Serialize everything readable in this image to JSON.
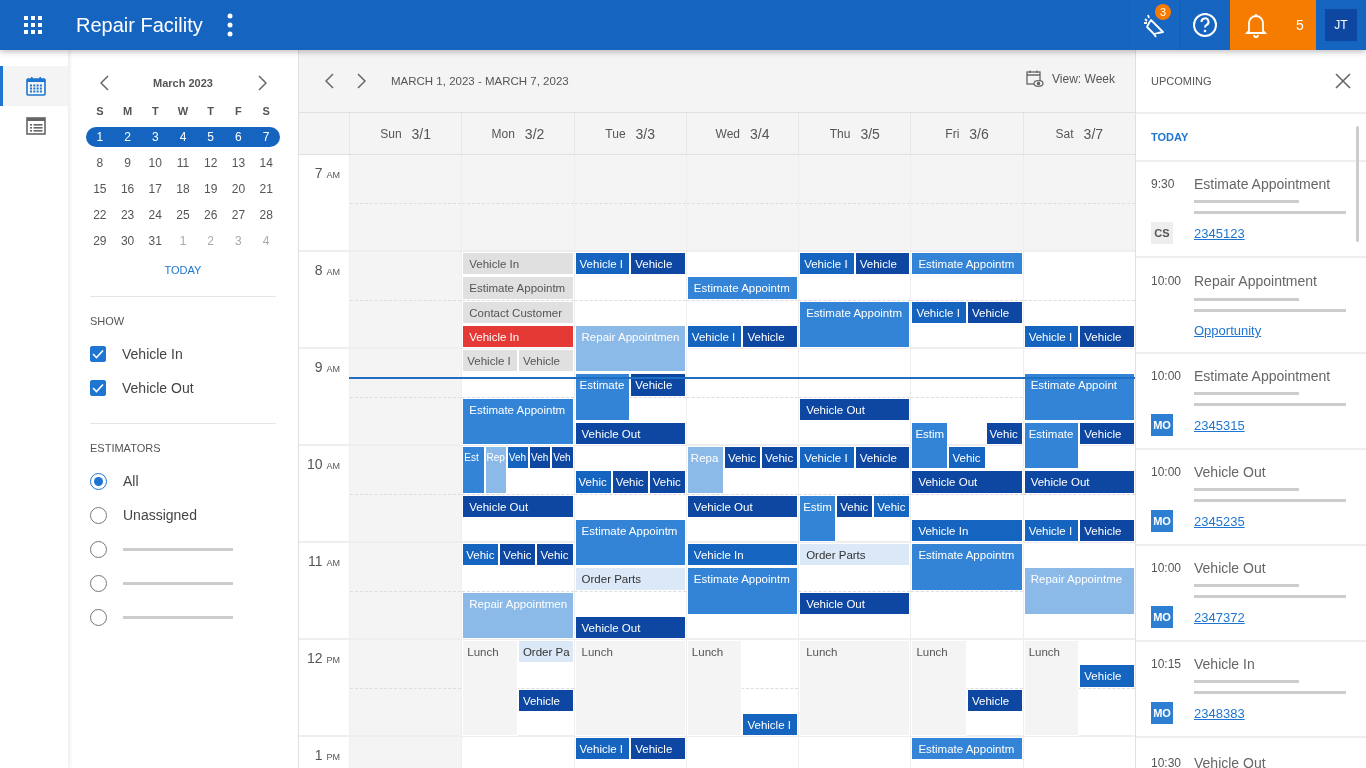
{
  "app_bar": {
    "title": "Repair Facility",
    "announcements_badge": "3",
    "notifications_count": "5",
    "user_initials": "JT"
  },
  "rail": [
    {
      "kind": "calendar",
      "selected": true
    },
    {
      "kind": "list",
      "selected": false
    }
  ],
  "mini_calendar": {
    "month": "March 2023",
    "weekdays": [
      "S",
      "M",
      "T",
      "W",
      "T",
      "F",
      "S"
    ],
    "weeks": [
      {
        "selected": true,
        "days": [
          {
            "label": "1",
            "muted": false
          },
          {
            "label": "2",
            "muted": false
          },
          {
            "label": "3",
            "muted": false
          },
          {
            "label": "4",
            "muted": false
          },
          {
            "label": "5",
            "muted": false
          },
          {
            "label": "6",
            "muted": false
          },
          {
            "label": "7",
            "muted": false
          }
        ]
      },
      {
        "selected": false,
        "days": [
          {
            "label": "8",
            "muted": false
          },
          {
            "label": "9",
            "muted": false
          },
          {
            "label": "10",
            "muted": false
          },
          {
            "label": "11",
            "muted": false
          },
          {
            "label": "12",
            "muted": false
          },
          {
            "label": "13",
            "muted": false
          },
          {
            "label": "14",
            "muted": false
          }
        ]
      },
      {
        "selected": false,
        "days": [
          {
            "label": "15",
            "muted": false
          },
          {
            "label": "16",
            "muted": false
          },
          {
            "label": "17",
            "muted": false
          },
          {
            "label": "18",
            "muted": false
          },
          {
            "label": "19",
            "muted": false
          },
          {
            "label": "20",
            "muted": false
          },
          {
            "label": "21",
            "muted": false
          }
        ]
      },
      {
        "selected": false,
        "days": [
          {
            "label": "22",
            "muted": false
          },
          {
            "label": "23",
            "muted": false
          },
          {
            "label": "24",
            "muted": false
          },
          {
            "label": "25",
            "muted": false
          },
          {
            "label": "26",
            "muted": false
          },
          {
            "label": "27",
            "muted": false
          },
          {
            "label": "28",
            "muted": false
          }
        ]
      },
      {
        "selected": false,
        "days": [
          {
            "label": "29",
            "muted": false
          },
          {
            "label": "30",
            "muted": false
          },
          {
            "label": "31",
            "muted": false
          },
          {
            "label": "1",
            "muted": true
          },
          {
            "label": "2",
            "muted": true
          },
          {
            "label": "3",
            "muted": true
          },
          {
            "label": "4",
            "muted": true
          }
        ]
      }
    ],
    "today_link": "TODAY"
  },
  "show": {
    "title": "SHOW",
    "options": [
      {
        "label": "Vehicle In",
        "checked": true
      },
      {
        "label": "Vehicle Out",
        "checked": true
      }
    ]
  },
  "estimators": {
    "title": "ESTIMATORS",
    "options": [
      {
        "kind": "text",
        "label": "All",
        "selected": true
      },
      {
        "kind": "text",
        "label": "Unassigned",
        "selected": false
      },
      {
        "kind": "skeleton",
        "selected": false
      },
      {
        "kind": "skeleton",
        "selected": false
      },
      {
        "kind": "skeleton",
        "selected": false
      }
    ]
  },
  "toolbar": {
    "range": "MARCH 1, 2023 - MARCH 7, 2023",
    "view": "View: Week"
  },
  "hours": [
    {
      "hour": "7",
      "period": "AM",
      "open": false,
      "now": false
    },
    {
      "hour": "8",
      "period": "AM",
      "open": true,
      "now": false
    },
    {
      "hour": "9",
      "period": "AM",
      "open": true,
      "now": true
    },
    {
      "hour": "10",
      "period": "AM",
      "open": true,
      "now": false
    },
    {
      "hour": "11",
      "period": "AM",
      "open": true,
      "now": false
    },
    {
      "hour": "12",
      "period": "PM",
      "open": true,
      "now": false
    },
    {
      "hour": "1",
      "period": "PM",
      "open": true,
      "now": false
    }
  ],
  "days": [
    {
      "weekday": "Sun",
      "date": "3/1",
      "closed": true
    },
    {
      "weekday": "Mon",
      "date": "3/2",
      "closed": false,
      "quarters": [
        [
          {
            "kind": "free"
          }
        ],
        [
          {
            "kind": "free"
          }
        ],
        [
          {
            "kind": "free"
          }
        ],
        [
          {
            "kind": "free"
          }
        ],
        [
          {
            "label": "Vehicle In",
            "kind": "past"
          }
        ],
        [
          {
            "label": "Estimate Appointm",
            "kind": "past"
          }
        ],
        [
          {
            "label": "Contact Customer",
            "kind": "past"
          }
        ],
        [
          {
            "label": "Vehicle In",
            "kind": "late"
          }
        ],
        [
          {
            "label": "Vehicle I",
            "kind": "past"
          },
          {
            "label": "Vehicle",
            "kind": "past"
          }
        ],
        [
          {
            "kind": "free"
          }
        ],
        [
          {
            "label": "Estimate Appointm",
            "kind": "estimate"
          }
        ],
        [
          {
            "kind": "continued"
          }
        ],
        [
          {
            "label": "Est",
            "kind": "estimate"
          },
          {
            "label": "Rep",
            "kind": "repair"
          },
          {
            "label": "Veh",
            "kind": "vehicle-in"
          },
          {
            "label": "Veh",
            "kind": "vehicle-out"
          },
          {
            "label": "Veh",
            "kind": "vehicle-out"
          }
        ],
        [
          {
            "kind": "continued"
          },
          {
            "kind": "continued"
          },
          {
            "kind": "free"
          },
          {
            "kind": "free"
          },
          {
            "kind": "free"
          }
        ],
        [
          {
            "label": "Vehicle Out",
            "kind": "vehicle-out"
          }
        ],
        [
          {
            "kind": "free"
          }
        ],
        [
          {
            "label": "Vehic",
            "kind": "vehicle-in"
          },
          {
            "label": "Vehic",
            "kind": "vehicle-out"
          },
          {
            "label": "Vehic",
            "kind": "vehicle-out"
          }
        ],
        [
          {
            "kind": "free"
          }
        ],
        [
          {
            "label": "Repair Appointmen",
            "kind": "repair"
          }
        ],
        [
          {
            "kind": "continued"
          }
        ],
        [
          {
            "label": "Lunch",
            "kind": "lunch"
          },
          {
            "label": "Order Pa",
            "kind": "order-parts"
          }
        ],
        [
          {
            "kind": "continued"
          },
          {
            "kind": "free"
          }
        ],
        [
          {
            "kind": "continued"
          },
          {
            "label": "Vehicle",
            "kind": "vehicle-out"
          }
        ],
        [
          {
            "kind": "continued"
          },
          {
            "kind": "free"
          }
        ],
        [
          {
            "kind": "free"
          }
        ]
      ]
    },
    {
      "weekday": "Tue",
      "date": "3/3",
      "closed": false,
      "quarters": [
        [
          {
            "kind": "free"
          }
        ],
        [
          {
            "kind": "free"
          }
        ],
        [
          {
            "kind": "free"
          }
        ],
        [
          {
            "kind": "free"
          }
        ],
        [
          {
            "label": "Vehicle I",
            "kind": "vehicle-in"
          },
          {
            "label": "Vehicle",
            "kind": "vehicle-out"
          }
        ],
        [
          {
            "kind": "free"
          }
        ],
        [
          {
            "kind": "free"
          }
        ],
        [
          {
            "label": "Repair Appointmen",
            "kind": "repair"
          }
        ],
        [
          {
            "kind": "continued"
          }
        ],
        [
          {
            "label": "Estimate",
            "kind": "estimate"
          },
          {
            "label": "Vehicle",
            "kind": "vehicle-out"
          }
        ],
        [
          {
            "kind": "continued"
          },
          {
            "kind": "free"
          }
        ],
        [
          {
            "label": "Vehicle Out",
            "kind": "vehicle-out"
          }
        ],
        [
          {
            "kind": "free"
          }
        ],
        [
          {
            "label": "Vehic",
            "kind": "vehicle-in"
          },
          {
            "label": "Vehic",
            "kind": "vehicle-out"
          },
          {
            "label": "Vehic",
            "kind": "vehicle-out"
          }
        ],
        [
          {
            "kind": "free"
          }
        ],
        [
          {
            "label": "Estimate Appointm",
            "kind": "estimate"
          }
        ],
        [
          {
            "kind": "continued"
          }
        ],
        [
          {
            "label": "Order Parts",
            "kind": "order-parts"
          }
        ],
        [
          {
            "kind": "free"
          }
        ],
        [
          {
            "label": "Vehicle Out",
            "kind": "vehicle-out"
          }
        ],
        [
          {
            "label": "Lunch",
            "kind": "lunch"
          }
        ],
        [
          {
            "kind": "continued"
          }
        ],
        [
          {
            "kind": "continued"
          }
        ],
        [
          {
            "kind": "continued"
          }
        ],
        [
          {
            "label": "Vehicle I",
            "kind": "vehicle-in"
          },
          {
            "label": "Vehicle",
            "kind": "vehicle-out"
          }
        ]
      ]
    },
    {
      "weekday": "Wed",
      "date": "3/4",
      "closed": false,
      "quarters": [
        [
          {
            "kind": "free"
          }
        ],
        [
          {
            "kind": "free"
          }
        ],
        [
          {
            "kind": "free"
          }
        ],
        [
          {
            "kind": "free"
          }
        ],
        [
          {
            "kind": "free"
          }
        ],
        [
          {
            "label": "Estimate Appointm",
            "kind": "estimate"
          }
        ],
        [
          {
            "kind": "free"
          }
        ],
        [
          {
            "label": "Vehicle I",
            "kind": "vehicle-in"
          },
          {
            "label": "Vehicle",
            "kind": "vehicle-out"
          }
        ],
        [
          {
            "kind": "free"
          }
        ],
        [
          {
            "kind": "free"
          }
        ],
        [
          {
            "kind": "free"
          }
        ],
        [
          {
            "kind": "free"
          }
        ],
        [
          {
            "label": "Repa",
            "kind": "repair"
          },
          {
            "label": "Vehic",
            "kind": "vehicle-out"
          },
          {
            "label": "Vehic",
            "kind": "vehicle-out"
          }
        ],
        [
          {
            "kind": "continued"
          },
          {
            "kind": "free"
          },
          {
            "kind": "free"
          }
        ],
        [
          {
            "label": "Vehicle Out",
            "kind": "vehicle-out"
          }
        ],
        [
          {
            "kind": "free"
          }
        ],
        [
          {
            "label": "Vehicle In",
            "kind": "vehicle-in"
          }
        ],
        [
          {
            "label": "Estimate Appointm",
            "kind": "estimate"
          }
        ],
        [
          {
            "kind": "continued"
          }
        ],
        [
          {
            "kind": "free"
          }
        ],
        [
          {
            "label": "Lunch",
            "kind": "lunch"
          },
          {
            "kind": "free"
          }
        ],
        [
          {
            "kind": "continued"
          },
          {
            "kind": "free"
          }
        ],
        [
          {
            "kind": "continued"
          },
          {
            "kind": "free"
          }
        ],
        [
          {
            "kind": "continued"
          },
          {
            "label": "Vehicle I",
            "kind": "vehicle-in"
          }
        ],
        [
          {
            "kind": "free"
          }
        ]
      ]
    },
    {
      "weekday": "Thu",
      "date": "3/5",
      "closed": false,
      "quarters": [
        [
          {
            "kind": "free"
          }
        ],
        [
          {
            "kind": "free"
          }
        ],
        [
          {
            "kind": "free"
          }
        ],
        [
          {
            "kind": "free"
          }
        ],
        [
          {
            "label": "Vehicle I",
            "kind": "vehicle-in"
          },
          {
            "label": "Vehicle",
            "kind": "vehicle-out"
          }
        ],
        [
          {
            "kind": "free"
          }
        ],
        [
          {
            "label": "Estimate Appointm",
            "kind": "estimate"
          }
        ],
        [
          {
            "kind": "continued"
          }
        ],
        [
          {
            "kind": "free"
          }
        ],
        [
          {
            "kind": "free"
          }
        ],
        [
          {
            "label": "Vehicle Out",
            "kind": "vehicle-out"
          }
        ],
        [
          {
            "kind": "free"
          }
        ],
        [
          {
            "label": "Vehicle I",
            "kind": "vehicle-in"
          },
          {
            "label": "Vehicle",
            "kind": "vehicle-out"
          }
        ],
        [
          {
            "kind": "free"
          }
        ],
        [
          {
            "label": "Estim",
            "kind": "estimate"
          },
          {
            "label": "Vehic",
            "kind": "vehicle-out"
          },
          {
            "label": "Vehic",
            "kind": "vehicle-in"
          }
        ],
        [
          {
            "kind": "continued"
          },
          {
            "kind": "free"
          },
          {
            "kind": "free"
          }
        ],
        [
          {
            "label": "Order Parts",
            "kind": "order-parts"
          }
        ],
        [
          {
            "kind": "free"
          }
        ],
        [
          {
            "label": "Vehicle Out",
            "kind": "vehicle-out"
          }
        ],
        [
          {
            "kind": "free"
          }
        ],
        [
          {
            "label": "Lunch",
            "kind": "lunch"
          }
        ],
        [
          {
            "kind": "continued"
          }
        ],
        [
          {
            "kind": "continued"
          }
        ],
        [
          {
            "kind": "continued"
          }
        ],
        [
          {
            "kind": "free"
          }
        ]
      ]
    },
    {
      "weekday": "Fri",
      "date": "3/6",
      "closed": false,
      "quarters": [
        [
          {
            "kind": "free"
          }
        ],
        [
          {
            "kind": "free"
          }
        ],
        [
          {
            "kind": "free"
          }
        ],
        [
          {
            "kind": "free"
          }
        ],
        [
          {
            "label": "Estimate Appointm",
            "kind": "estimate"
          }
        ],
        [
          {
            "kind": "free"
          }
        ],
        [
          {
            "label": "Vehicle I",
            "kind": "vehicle-in"
          },
          {
            "label": "Vehicle",
            "kind": "vehicle-out"
          }
        ],
        [
          {
            "kind": "free"
          }
        ],
        [
          {
            "kind": "free"
          }
        ],
        [
          {
            "kind": "free"
          }
        ],
        [
          {
            "kind": "free"
          }
        ],
        [
          {
            "label": "Estim",
            "kind": "estimate"
          },
          {
            "kind": "free"
          },
          {
            "label": "Vehic",
            "kind": "vehicle-out"
          }
        ],
        [
          {
            "kind": "continued"
          },
          {
            "label": "Vehic",
            "kind": "vehicle-in"
          },
          {
            "kind": "free"
          }
        ],
        [
          {
            "label": "Vehicle Out",
            "kind": "vehicle-out"
          }
        ],
        [
          {
            "kind": "free"
          }
        ],
        [
          {
            "label": "Vehicle In",
            "kind": "vehicle-in"
          }
        ],
        [
          {
            "label": "Estimate Appointm",
            "kind": "estimate"
          }
        ],
        [
          {
            "kind": "continued"
          }
        ],
        [
          {
            "kind": "free"
          }
        ],
        [
          {
            "kind": "free"
          }
        ],
        [
          {
            "label": "Lunch",
            "kind": "lunch"
          },
          {
            "kind": "free"
          }
        ],
        [
          {
            "kind": "continued"
          },
          {
            "kind": "free"
          }
        ],
        [
          {
            "kind": "continued"
          },
          {
            "label": "Vehicle",
            "kind": "vehicle-out"
          }
        ],
        [
          {
            "kind": "continued"
          },
          {
            "kind": "free"
          }
        ],
        [
          {
            "label": "Estimate Appointm",
            "kind": "estimate"
          }
        ]
      ]
    },
    {
      "weekday": "Sat",
      "date": "3/7",
      "closed": false,
      "quarters": [
        [
          {
            "kind": "free"
          }
        ],
        [
          {
            "kind": "free"
          }
        ],
        [
          {
            "kind": "free"
          }
        ],
        [
          {
            "kind": "free"
          }
        ],
        [
          {
            "kind": "free"
          }
        ],
        [
          {
            "kind": "free"
          }
        ],
        [
          {
            "kind": "free"
          }
        ],
        [
          {
            "label": "Vehicle I",
            "kind": "vehicle-in"
          },
          {
            "label": "Vehicle",
            "kind": "vehicle-out"
          }
        ],
        [
          {
            "kind": "free"
          }
        ],
        [
          {
            "label": "Estimate Appoint",
            "kind": "estimate"
          }
        ],
        [
          {
            "kind": "continued"
          }
        ],
        [
          {
            "label": "Estimate",
            "kind": "estimate"
          },
          {
            "label": "Vehicle",
            "kind": "vehicle-out"
          }
        ],
        [
          {
            "kind": "continued"
          },
          {
            "kind": "free"
          }
        ],
        [
          {
            "label": "Vehicle Out",
            "kind": "vehicle-out"
          }
        ],
        [
          {
            "kind": "free"
          }
        ],
        [
          {
            "label": "Vehicle I",
            "kind": "vehicle-in"
          },
          {
            "label": "Vehicle",
            "kind": "vehicle-out"
          }
        ],
        [
          {
            "kind": "free"
          }
        ],
        [
          {
            "label": "Repair Appointme",
            "kind": "repair"
          }
        ],
        [
          {
            "kind": "continued"
          }
        ],
        [
          {
            "kind": "free"
          }
        ],
        [
          {
            "label": "Lunch",
            "kind": "lunch"
          },
          {
            "kind": "free"
          }
        ],
        [
          {
            "kind": "continued"
          },
          {
            "label": "Vehicle",
            "kind": "vehicle-in"
          }
        ],
        [
          {
            "kind": "continued"
          },
          {
            "kind": "free"
          }
        ],
        [
          {
            "kind": "continued"
          },
          {
            "kind": "free"
          }
        ],
        [
          {
            "kind": "free"
          }
        ]
      ]
    }
  ],
  "upcoming": {
    "title": "UPCOMING",
    "section": "TODAY",
    "items": [
      {
        "time": "9:30",
        "title": "Estimate Appointment",
        "avatar": {
          "initials": "CS",
          "color": "#eeeeee"
        },
        "link": "2345123"
      },
      {
        "time": "10:00",
        "title": "Repair Appointment",
        "link": "Opportunity"
      },
      {
        "time": "10:00",
        "title": "Estimate Appointment",
        "avatar": {
          "initials": "MO",
          "color": "#2f7fd1"
        },
        "link": "2345315"
      },
      {
        "time": "10:00",
        "title": "Vehicle Out",
        "avatar": {
          "initials": "MO",
          "color": "#2f7fd1"
        },
        "link": "2345235"
      },
      {
        "time": "10:00",
        "title": "Vehicle Out",
        "avatar": {
          "initials": "MO",
          "color": "#2f7fd1"
        },
        "link": "2347372"
      },
      {
        "time": "10:15",
        "title": "Vehicle In",
        "avatar": {
          "initials": "MO",
          "color": "#2f7fd1"
        },
        "link": "2348383"
      },
      {
        "time": "10:30",
        "title": "Vehicle Out"
      }
    ]
  }
}
